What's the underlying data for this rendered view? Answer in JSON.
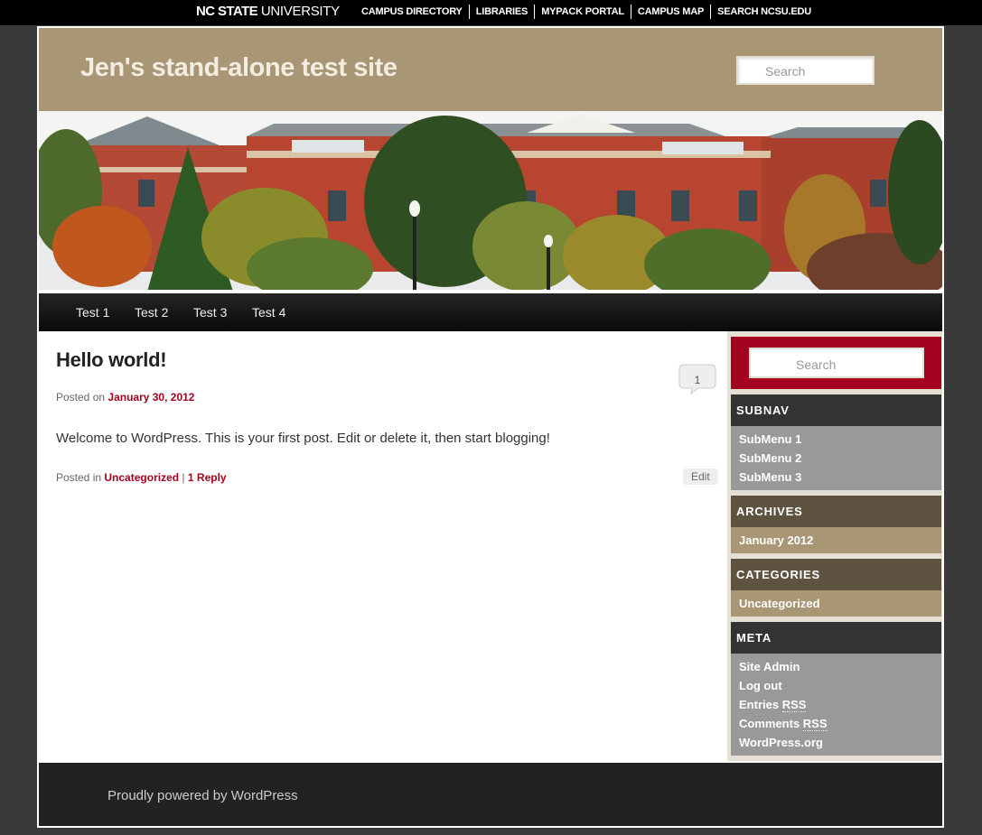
{
  "topbar": {
    "logo_bold": "NC STATE",
    "logo_light": " UNIVERSITY",
    "links": [
      "CAMPUS DIRECTORY",
      "LIBRARIES",
      "MYPACK PORTAL",
      "CAMPUS MAP",
      "SEARCH NCSU.EDU"
    ]
  },
  "header": {
    "site_title": "Jen's stand-alone test site",
    "search_placeholder": "Search",
    "brand_color": "#a89675"
  },
  "nav": {
    "items": [
      "Test 1",
      "Test 2",
      "Test 3",
      "Test 4"
    ]
  },
  "post": {
    "title": "Hello world!",
    "posted_on_label": "Posted on",
    "date": "January 30, 2012",
    "comment_count": "1",
    "content": "Welcome to WordPress. This is your first post. Edit or delete it, then start blogging!",
    "posted_in_label": "Posted in",
    "category": "Uncategorized",
    "separator": "|",
    "reply_link": "1 Reply",
    "edit_label": "Edit",
    "link_color": "#a4031f"
  },
  "sidebar": {
    "search_placeholder": "Search",
    "subnav": {
      "title": "SUBNAV",
      "items": [
        "SubMenu 1",
        "SubMenu 2",
        "SubMenu 3"
      ]
    },
    "archives": {
      "title": "ARCHIVES",
      "items": [
        "January 2012"
      ]
    },
    "categories": {
      "title": "CATEGORIES",
      "items": [
        "Uncategorized"
      ]
    },
    "meta": {
      "title": "META",
      "items": [
        "Site Admin",
        "Log out"
      ],
      "entries_prefix": "Entries ",
      "comments_prefix": "Comments ",
      "rss": "RSS",
      "wordpress_org": "WordPress.org"
    }
  },
  "footer": {
    "generator": "Proudly powered by WordPress"
  }
}
